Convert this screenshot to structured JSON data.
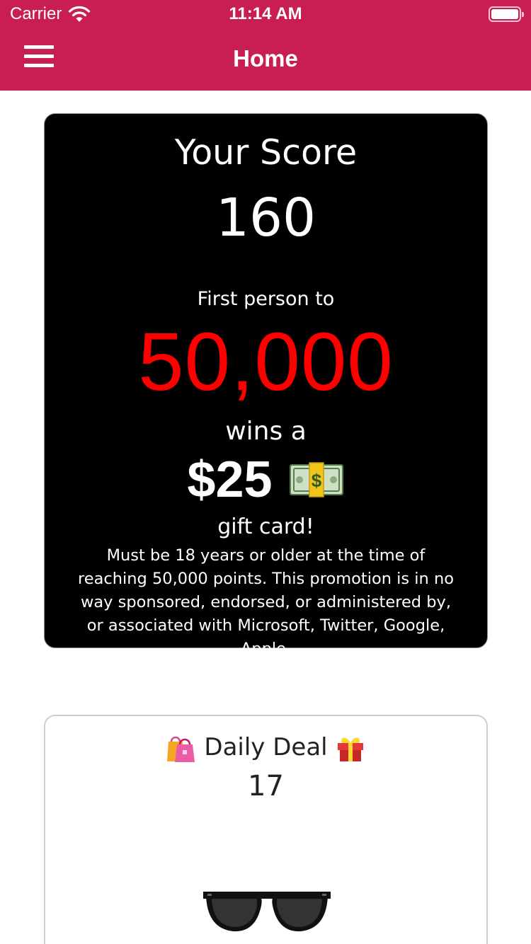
{
  "status_bar": {
    "carrier": "Carrier",
    "time": "11:14 AM"
  },
  "nav": {
    "title": "Home",
    "icons": [
      "hamburger-menu-icon"
    ]
  },
  "colors": {
    "header": "#c81e52",
    "score_card_bg": "#000000",
    "highlight": "#ff0000"
  },
  "score_card": {
    "title": "Your Score",
    "score": "160",
    "first_person": "First person to",
    "target": "50,000",
    "wins_a": "wins a",
    "prize": "$25",
    "prize_icon": "money-banknote-icon",
    "gift_card": "gift card!",
    "disclaimer": "Must be 18 years or older at the time of reaching 50,000 points. This promotion is in no way sponsored, endorsed, or administered by, or associated with Microsoft, Twitter, Google, Apple."
  },
  "daily_deal": {
    "title": "Daily Deal",
    "left_icon": "shopping-bags-icon",
    "right_icon": "gift-box-icon",
    "count": "17",
    "image": "sunglasses"
  }
}
